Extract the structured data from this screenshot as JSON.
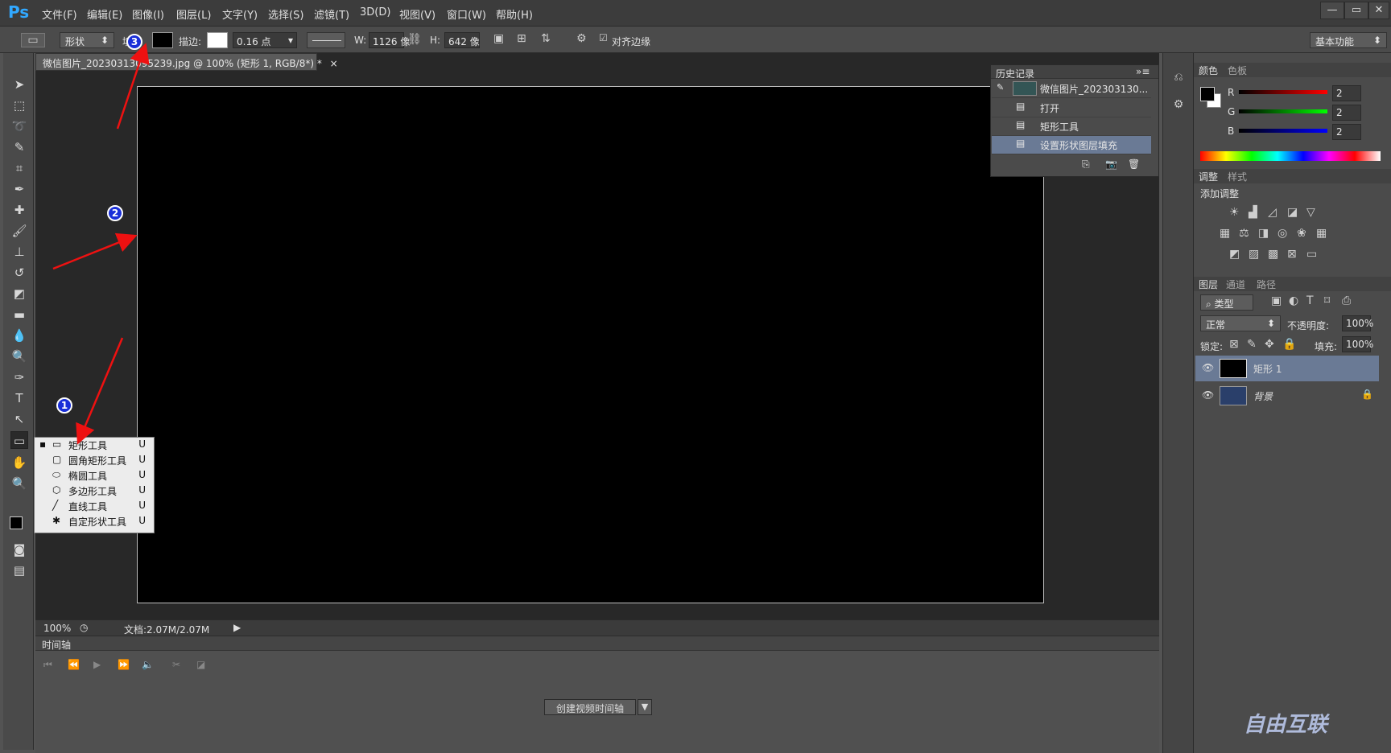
{
  "menubar": {
    "logo": "Ps",
    "items": [
      "文件(F)",
      "编辑(E)",
      "图像(I)",
      "图层(L)",
      "文字(Y)",
      "选择(S)",
      "滤镜(T)",
      "3D(D)",
      "视图(V)",
      "窗口(W)",
      "帮助(H)"
    ],
    "minimize": "—",
    "restore": "▭",
    "close": "✕"
  },
  "options": {
    "mode": "形状",
    "fill_label": "填",
    "stroke_label": "描边:",
    "stroke_width": "0.16 点",
    "w_label": "W:",
    "w_value": "1126 像",
    "h_label": "H:",
    "h_value": "642 像",
    "align_edges": "对齐边缘",
    "workspace": "基本功能"
  },
  "document": {
    "tab_title": "微信图片_20230313095239.jpg @ 100% (矩形 1, RGB/8*) *",
    "tab_close": "×",
    "zoom": "100%",
    "doc_size": "文档:2.07M/2.07M"
  },
  "history": {
    "title": "历史记录",
    "snapshot": "微信图片_202303130...",
    "items": [
      "打开",
      "矩形工具",
      "设置形状图层填充"
    ]
  },
  "color": {
    "tabs": [
      "颜色",
      "色板"
    ],
    "r_label": "R",
    "g_label": "G",
    "b_label": "B",
    "r": "2",
    "g": "2",
    "b": "2"
  },
  "adjust": {
    "tabs": [
      "调整",
      "样式"
    ],
    "title": "添加调整"
  },
  "layers": {
    "tabs": [
      "图层",
      "通道",
      "路径"
    ],
    "filter": "类型",
    "blend": "正常",
    "opacity_label": "不透明度:",
    "opacity": "100%",
    "lock_label": "锁定:",
    "fill_label": "填充:",
    "fill": "100%",
    "items": [
      {
        "name": "矩形 1"
      },
      {
        "name": "背景"
      }
    ]
  },
  "timeline": {
    "title": "时间轴",
    "create_button": "创建视频时间轴"
  },
  "flyout": {
    "items": [
      {
        "label": "矩形工具",
        "key": "U"
      },
      {
        "label": "圆角矩形工具",
        "key": "U"
      },
      {
        "label": "椭圆工具",
        "key": "U"
      },
      {
        "label": "多边形工具",
        "key": "U"
      },
      {
        "label": "直线工具",
        "key": "U"
      },
      {
        "label": "自定形状工具",
        "key": "U"
      }
    ]
  },
  "badges": [
    "1",
    "2",
    "3"
  ],
  "watermark": "自由互联"
}
